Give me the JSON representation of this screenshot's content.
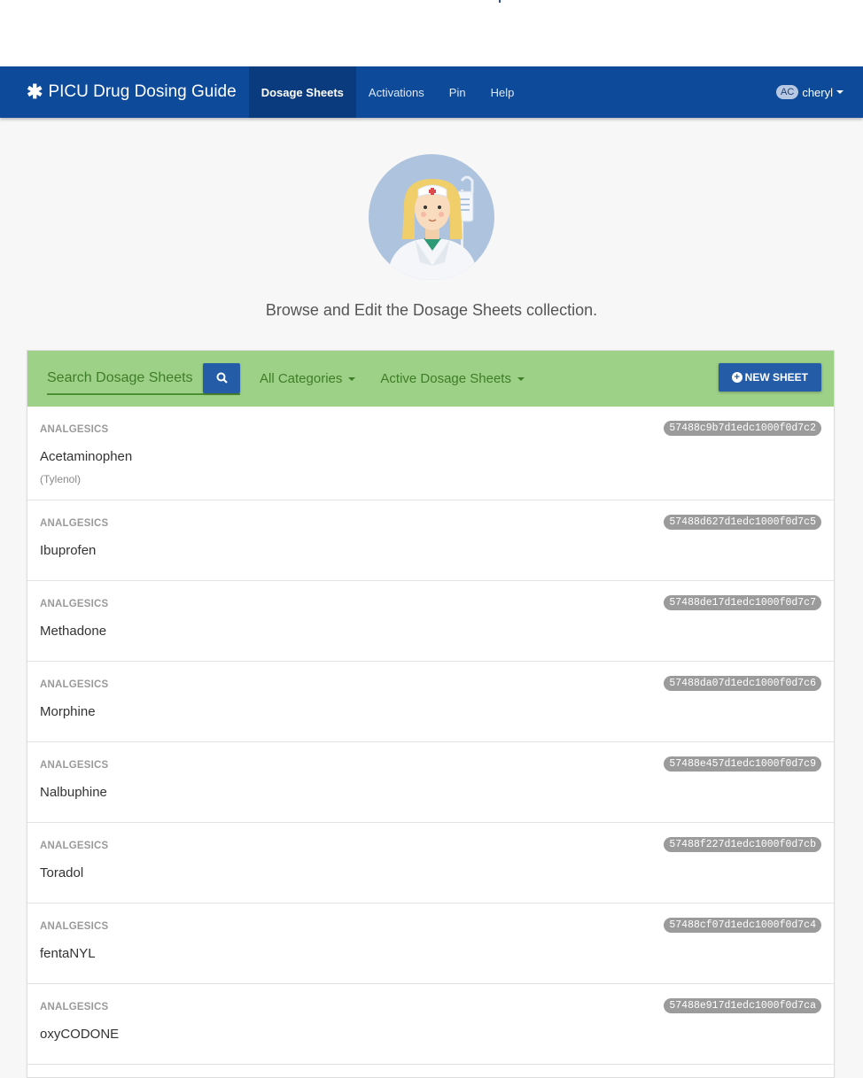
{
  "nav": {
    "brand": "PICU Drug Dosing Guide",
    "brand_icon": "asterisk-icon",
    "items": [
      {
        "label": "Dosage Sheets",
        "active": true
      },
      {
        "label": "Activations",
        "active": false
      },
      {
        "label": "Pin",
        "active": false
      },
      {
        "label": "Help",
        "active": false
      }
    ],
    "user_initials": "AC",
    "user_name": "cheryl"
  },
  "hero": {
    "tagline": "Browse and Edit the Dosage Sheets collection."
  },
  "toolbar": {
    "search_placeholder": "Search Dosage Sheets",
    "category_filter": "All Categories",
    "status_filter": "Active Dosage Sheets",
    "new_button": "NEW SHEET"
  },
  "sheets": [
    {
      "category": "ANALGESICS",
      "name": "Acetaminophen",
      "brand": "(Tylenol)",
      "id": "57488c9b7d1edc1000f0d7c2"
    },
    {
      "category": "ANALGESICS",
      "name": "Ibuprofen",
      "brand": "",
      "id": "57488d627d1edc1000f0d7c5"
    },
    {
      "category": "ANALGESICS",
      "name": "Methadone",
      "brand": "",
      "id": "57488de17d1edc1000f0d7c7"
    },
    {
      "category": "ANALGESICS",
      "name": "Morphine",
      "brand": "",
      "id": "57488da07d1edc1000f0d7c6"
    },
    {
      "category": "ANALGESICS",
      "name": "Nalbuphine",
      "brand": "",
      "id": "57488e457d1edc1000f0d7c9"
    },
    {
      "category": "ANALGESICS",
      "name": "Toradol",
      "brand": "",
      "id": "57488f227d1edc1000f0d7cb"
    },
    {
      "category": "ANALGESICS",
      "name": "fentaNYL",
      "brand": "",
      "id": "57488cf07d1edc1000f0d7c4"
    },
    {
      "category": "ANALGESICS",
      "name": "oxyCODONE",
      "brand": "",
      "id": "57488e917d1edc1000f0d7ca"
    }
  ],
  "colors": {
    "navbar": "#0d4a9a",
    "nav_active": "#0a3b7e",
    "toolbar": "#9ed188",
    "toolbar_text": "#3e7d27",
    "primary_button": "#245ca8",
    "badge": "#9b9b9b"
  }
}
